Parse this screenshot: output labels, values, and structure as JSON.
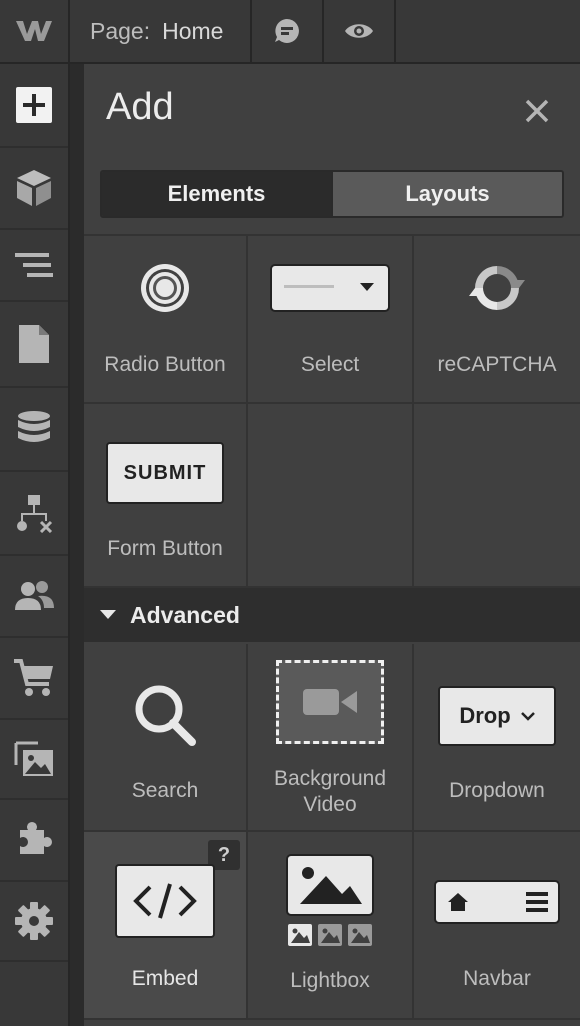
{
  "topbar": {
    "logo_icon": "webflow-logo-icon",
    "page_label": "Page:",
    "page_name": "Home",
    "comments_icon": "comment-icon",
    "preview_icon": "eye-icon"
  },
  "rail": {
    "items": [
      {
        "icon": "add-icon",
        "active": true
      },
      {
        "icon": "box-icon"
      },
      {
        "icon": "navigator-icon"
      },
      {
        "icon": "page-icon"
      },
      {
        "icon": "database-icon"
      },
      {
        "icon": "logic-icon"
      },
      {
        "icon": "users-icon"
      },
      {
        "icon": "cart-icon"
      },
      {
        "icon": "assets-icon"
      },
      {
        "icon": "puzzle-icon"
      },
      {
        "icon": "settings-icon"
      }
    ]
  },
  "panel": {
    "title": "Add",
    "tabs": {
      "elements": "Elements",
      "layouts": "Layouts"
    },
    "forms_items": [
      {
        "label": "Radio Button",
        "icon": "radio-button-icon"
      },
      {
        "label": "Select",
        "icon": "select-icon"
      },
      {
        "label": "reCAPTCHA",
        "icon": "recaptcha-icon"
      },
      {
        "label": "Form Button",
        "icon": "submit-button-icon",
        "button_text": "SUBMIT"
      }
    ],
    "advanced_title": "Advanced",
    "advanced_items": [
      {
        "label": "Search",
        "icon": "search-icon"
      },
      {
        "label1": "Background",
        "label2": "Video",
        "icon": "video-icon"
      },
      {
        "label": "Dropdown",
        "icon": "dropdown-icon",
        "button_text": "Drop"
      },
      {
        "label": "Embed",
        "icon": "code-icon",
        "help": "?"
      },
      {
        "label": "Lightbox",
        "icon": "image-icon"
      },
      {
        "label": "Navbar",
        "icon": "navbar-icon"
      }
    ]
  },
  "colors": {
    "bg_dark": "#2b2b2b",
    "panel": "#404040",
    "text": "#e6e6e6"
  }
}
